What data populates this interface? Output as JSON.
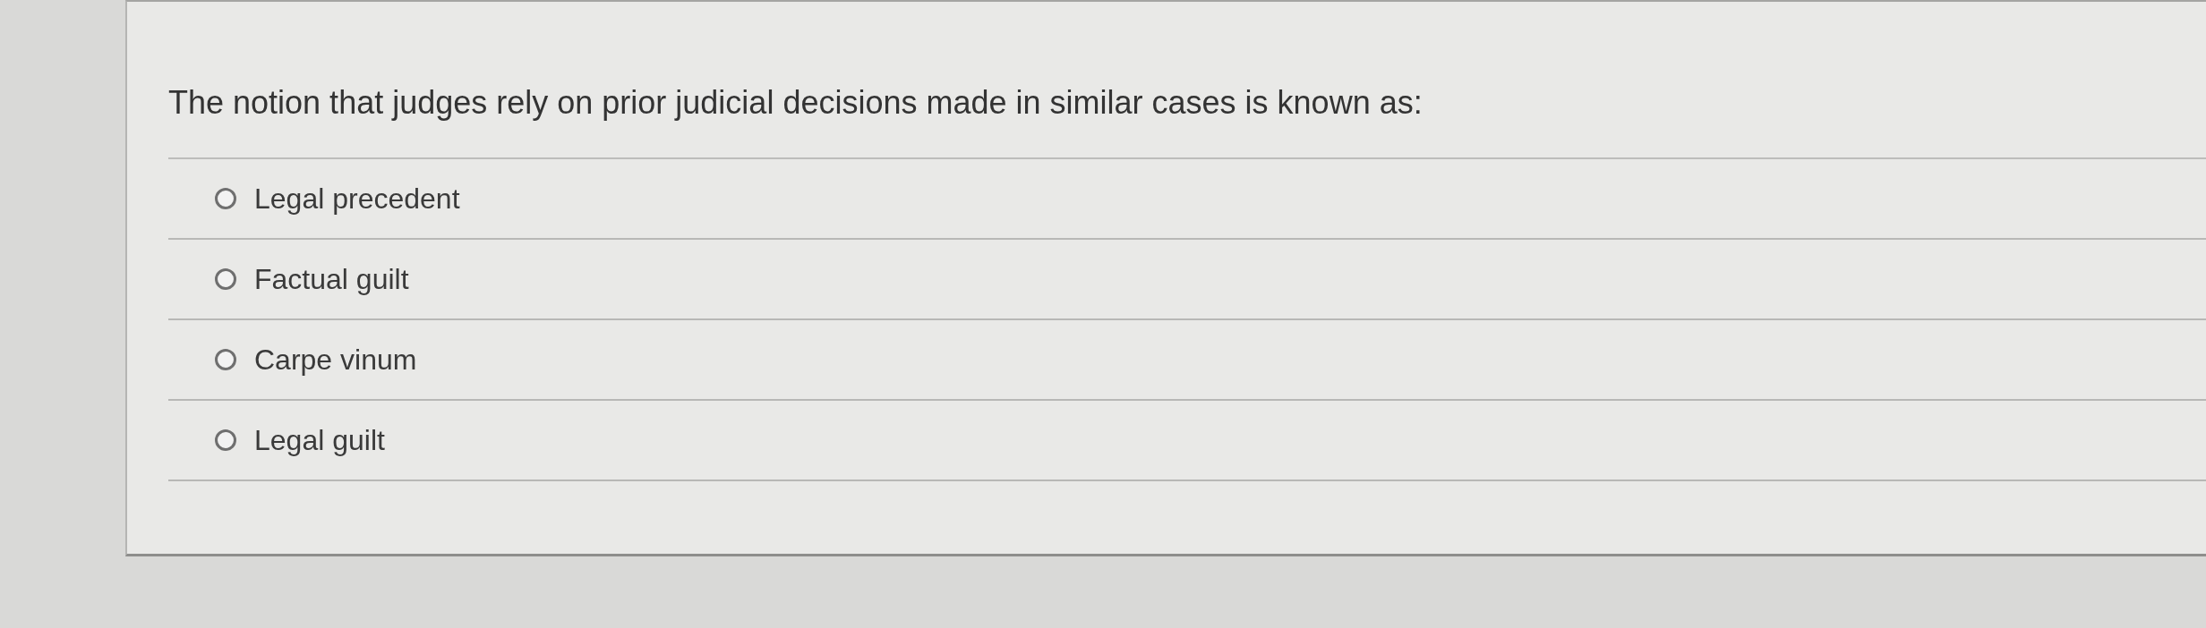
{
  "question": {
    "text": "The notion that judges rely on prior judicial decisions made in similar cases is known as:"
  },
  "options": [
    {
      "label": "Legal precedent",
      "selected": false
    },
    {
      "label": "Factual guilt",
      "selected": false
    },
    {
      "label": "Carpe vinum",
      "selected": false
    },
    {
      "label": "Legal guilt",
      "selected": false
    }
  ]
}
